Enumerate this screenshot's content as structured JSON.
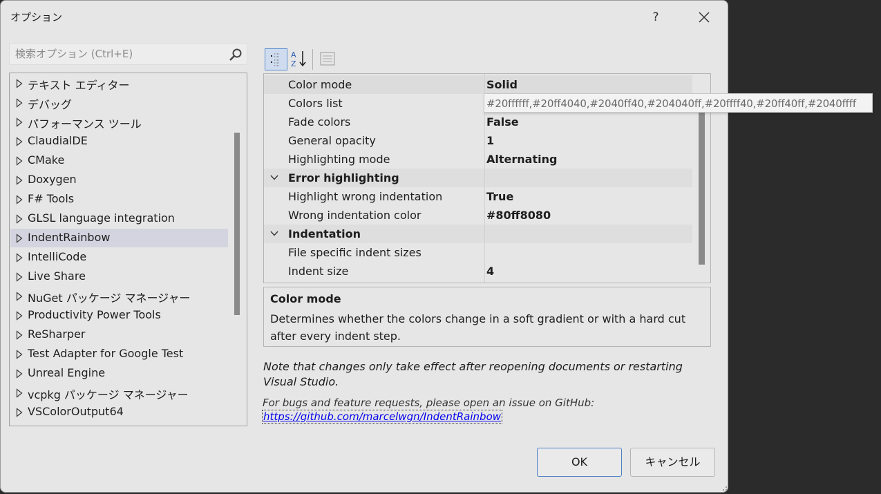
{
  "window": {
    "title": "オプション",
    "help_label": "?"
  },
  "search": {
    "placeholder": "検索オプション (Ctrl+E)"
  },
  "tree": {
    "items": [
      {
        "label": "テキスト エディター"
      },
      {
        "label": "デバッグ"
      },
      {
        "label": "パフォーマンス ツール"
      },
      {
        "label": "ClaudialDE"
      },
      {
        "label": "CMake"
      },
      {
        "label": "Doxygen"
      },
      {
        "label": "F# Tools"
      },
      {
        "label": "GLSL language integration"
      },
      {
        "label": "IndentRainbow",
        "selected": true
      },
      {
        "label": "IntelliCode"
      },
      {
        "label": "Live Share"
      },
      {
        "label": "NuGet パッケージ マネージャー"
      },
      {
        "label": "Productivity Power Tools"
      },
      {
        "label": "ReSharper"
      },
      {
        "label": "Test Adapter for Google Test"
      },
      {
        "label": "Unreal Engine"
      },
      {
        "label": "vcpkg パッケージ マネージャー"
      },
      {
        "label": "VSColorOutput64"
      }
    ]
  },
  "grid": {
    "rows": [
      {
        "type": "prop",
        "name": "Color mode",
        "value": "Solid"
      },
      {
        "type": "prop",
        "name": "Colors list",
        "value": ""
      },
      {
        "type": "prop",
        "name": "Fade colors",
        "value": "False"
      },
      {
        "type": "prop",
        "name": "General opacity",
        "value": "1"
      },
      {
        "type": "prop",
        "name": "Highlighting mode",
        "value": "Alternating"
      },
      {
        "type": "category",
        "name": "Error highlighting",
        "value": ""
      },
      {
        "type": "prop",
        "name": "Highlight wrong indentation",
        "value": "True"
      },
      {
        "type": "prop",
        "name": "Wrong indentation color",
        "value": "#80ff8080"
      },
      {
        "type": "category",
        "name": "Indentation",
        "value": ""
      },
      {
        "type": "prop",
        "name": "File specific indent sizes",
        "value": ""
      },
      {
        "type": "prop",
        "name": "Indent size",
        "value": "4"
      }
    ]
  },
  "tooltip": {
    "text": "#20ffffff,#20ff4040,#2040ff40,#204040ff,#20ffff40,#20ff40ff,#2040ffff"
  },
  "description": {
    "title": "Color mode",
    "text": "Determines whether the colors change in a soft gradient or with a hard cut after every indent step."
  },
  "note": {
    "text": "Note that changes only take effect after reopening documents or restarting Visual Studio.",
    "bugs_text": "For bugs and feature requests, please open an issue on GitHub:",
    "link_text": "https://github.com/marcelwgn/IndentRainbow"
  },
  "buttons": {
    "ok": "OK",
    "cancel": "キャンセル"
  },
  "colors": {
    "dialog_bg": "#e6e6e6",
    "selected_bg": "#d4d4e0",
    "accent": "#4d7fc4",
    "link": "#0000ee"
  }
}
